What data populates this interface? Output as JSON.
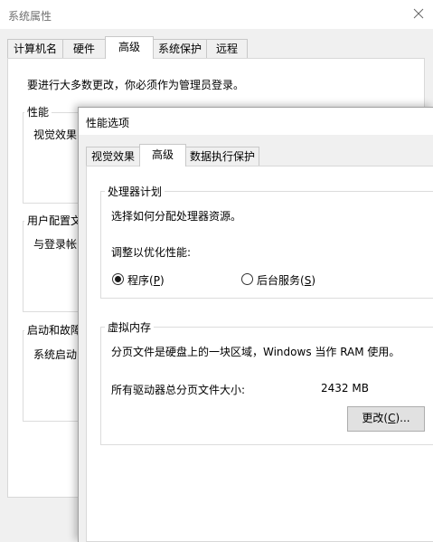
{
  "back_window": {
    "title": "系统属性",
    "tabs": [
      "计算机名",
      "硬件",
      "高级",
      "系统保护",
      "远程"
    ],
    "active_tab": "高级",
    "admin_notice": "要进行大多数更改，你必须作为管理员登录。",
    "groups": {
      "performance": {
        "label": "性能",
        "text": "视觉效果"
      },
      "user_profiles": {
        "label": "用户配置文",
        "text": "与登录帐"
      },
      "startup_recovery": {
        "label": "启动和故障",
        "text": "系统启动"
      }
    }
  },
  "perf_dialog": {
    "title": "性能选项",
    "tabs": [
      "视觉效果",
      "高级",
      "数据执行保护"
    ],
    "active_tab": "高级",
    "processor_scheduling": {
      "label": "处理器计划",
      "description": "选择如何分配处理器资源。",
      "adjust_label": "调整以优化性能:",
      "options": [
        {
          "label": "程序",
          "accesskey": "P",
          "selected": true
        },
        {
          "label": "后台服务",
          "accesskey": "S",
          "selected": false
        }
      ]
    },
    "virtual_memory": {
      "label": "虚拟内存",
      "description": "分页文件是硬盘上的一块区域，Windows 当作 RAM 使用。",
      "total_label": "所有驱动器总分页文件大小:",
      "total_value": "2432 MB",
      "change_button": "更改",
      "change_accesskey": "C",
      "change_suffix": "..."
    }
  }
}
